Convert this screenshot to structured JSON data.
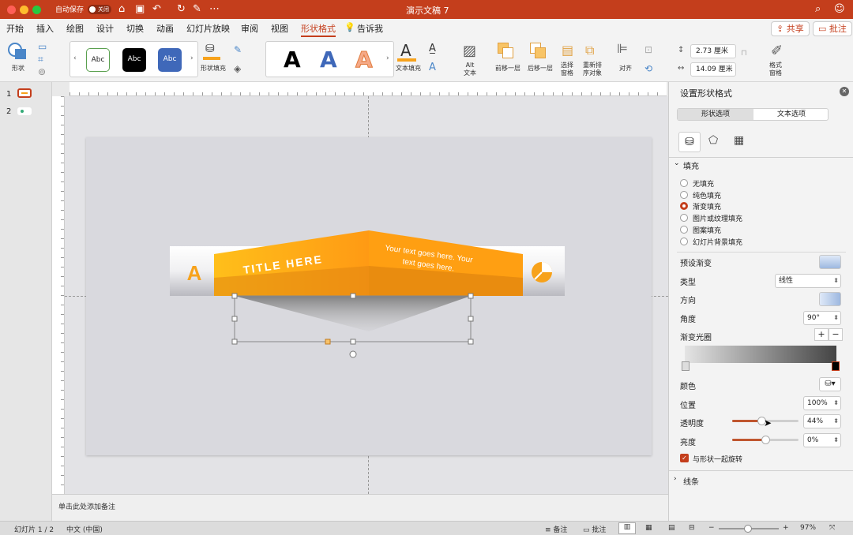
{
  "window": {
    "title": "演示文稿 7",
    "autosave_label": "自动保存",
    "autosave_state": "关闭"
  },
  "tabs": [
    "开始",
    "插入",
    "绘图",
    "设计",
    "切换",
    "动画",
    "幻灯片放映",
    "审阅",
    "视图",
    "形状格式"
  ],
  "tell_me": "告诉我",
  "share_label": "共享",
  "comments_label": "批注",
  "ribbon": {
    "shape_label": "形状",
    "style_samples": [
      "Abc",
      "Abc",
      "Abc"
    ],
    "shape_fill_label": "形状填充",
    "wordart_letters": [
      "A",
      "A",
      "A"
    ],
    "text_fill_label": "文本填充",
    "alt_text_label": "Alt\n文本",
    "bring_forward": "前移一层",
    "send_backward": "后移一层",
    "selection_pane": "选择\n窗格",
    "reorder": "重新排\n序对象",
    "align": "对齐",
    "height_value": "2.73 厘米",
    "width_value": "14.09 厘米",
    "format_pane": "格式\n窗格"
  },
  "thumbnails": [
    "1",
    "2"
  ],
  "slide": {
    "left_letter": "A",
    "title_text": "TITLE HERE",
    "body_text": "Your text goes here. Your text goes here."
  },
  "notes_placeholder": "单击此处添加备注",
  "panel": {
    "title": "设置形状格式",
    "tab_shape": "形状选项",
    "tab_text": "文本选项",
    "fill_section": "填充",
    "fill_options": [
      "无填充",
      "纯色填充",
      "渐变填充",
      "图片或纹理填充",
      "图案填充",
      "幻灯片背景填充"
    ],
    "selected_fill": "渐变填充",
    "preset_label": "预设渐变",
    "type_label": "类型",
    "type_value": "线性",
    "direction_label": "方向",
    "angle_label": "角度",
    "angle_value": "90°",
    "stops_label": "渐变光圈",
    "color_label": "颜色",
    "position_label": "位置",
    "position_value": "100%",
    "transparency_label": "透明度",
    "transparency_value": "44%",
    "transparency_level": 0.44,
    "brightness_label": "亮度",
    "brightness_value": "0%",
    "brightness_level": 0.5,
    "rotate_label": "与形状一起旋转",
    "line_section": "线条"
  },
  "status": {
    "slide_info": "幻灯片 1 / 2",
    "language": "中文 (中国)",
    "notes": "备注",
    "comments": "批注",
    "zoom": "97%"
  },
  "colors": {
    "accent": "#c43e1c",
    "orange": "#f7a21b"
  }
}
